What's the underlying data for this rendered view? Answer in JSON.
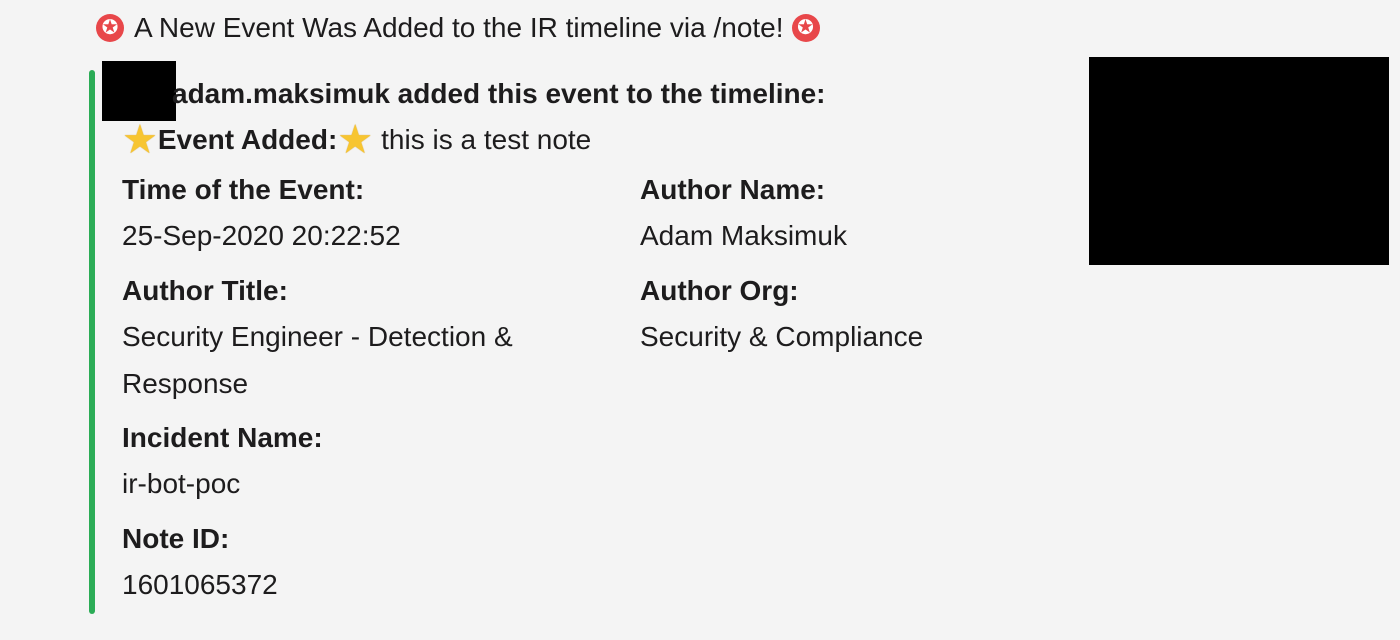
{
  "header": {
    "title": "A New Event Was Added to the IR timeline via /note!",
    "badge_icon": "shield-badge-icon"
  },
  "attachment": {
    "author_line": "adam.maksimuk added this event to the timeline:",
    "event_label": "Event Added:",
    "event_text": "this is a test note",
    "fields": {
      "time_of_event": {
        "title": "Time of the Event:",
        "value": "25-Sep-2020 20:22:52"
      },
      "author_name": {
        "title": "Author Name:",
        "value": "Adam Maksimuk"
      },
      "author_title": {
        "title": "Author Title:",
        "value": "Security Engineer - Detection & Response"
      },
      "author_org": {
        "title": "Author Org:",
        "value": "Security & Compliance"
      },
      "incident_name": {
        "title": "Incident Name:",
        "value": "ir-bot-poc"
      },
      "note_id": {
        "title": "Note ID:",
        "value": "1601065372"
      }
    }
  },
  "colors": {
    "background": "#f4f4f4",
    "accent_bar": "#2bac56",
    "badge": "#e8474a",
    "star": "#f7c531",
    "redaction": "#000000"
  }
}
